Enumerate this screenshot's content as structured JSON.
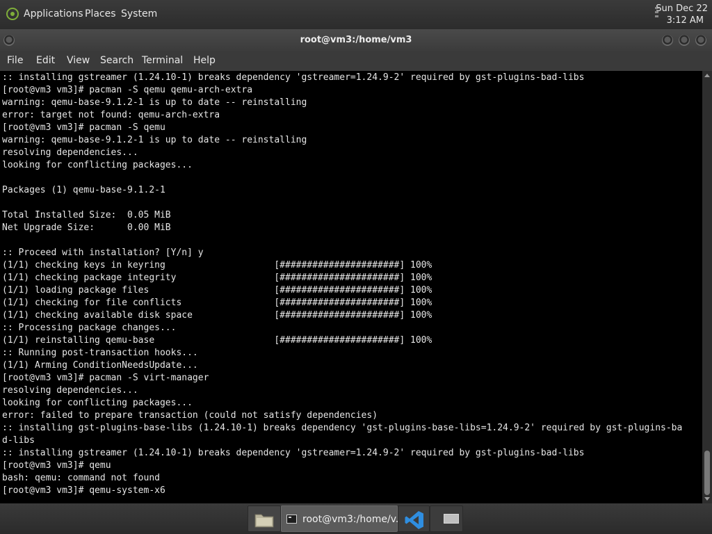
{
  "top_panel": {
    "menus": [
      "Applications",
      "Places",
      "System"
    ],
    "clock_date": "Sun Dec 22",
    "clock_time": "3:12 AM"
  },
  "window": {
    "title": "root@vm3:/home/vm3",
    "menubar": [
      "File",
      "Edit",
      "View",
      "Search",
      "Terminal",
      "Help"
    ]
  },
  "terminal": {
    "lines": [
      ":: installing gstreamer (1.24.10-1) breaks dependency 'gstreamer=1.24.9-2' required by gst-plugins-bad-libs",
      "[root@vm3 vm3]# pacman -S qemu qemu-arch-extra",
      "warning: qemu-base-9.1.2-1 is up to date -- reinstalling",
      "error: target not found: qemu-arch-extra",
      "[root@vm3 vm3]# pacman -S qemu",
      "warning: qemu-base-9.1.2-1 is up to date -- reinstalling",
      "resolving dependencies...",
      "looking for conflicting packages...",
      "",
      "Packages (1) qemu-base-9.1.2-1",
      "",
      "Total Installed Size:  0.05 MiB",
      "Net Upgrade Size:      0.00 MiB",
      "",
      ":: Proceed with installation? [Y/n] y",
      "(1/1) checking keys in keyring                    [######################] 100%",
      "(1/1) checking package integrity                  [######################] 100%",
      "(1/1) loading package files                       [######################] 100%",
      "(1/1) checking for file conflicts                 [######################] 100%",
      "(1/1) checking available disk space               [######################] 100%",
      ":: Processing package changes...",
      "(1/1) reinstalling qemu-base                      [######################] 100%",
      ":: Running post-transaction hooks...",
      "(1/1) Arming ConditionNeedsUpdate...",
      "[root@vm3 vm3]# pacman -S virt-manager",
      "resolving dependencies...",
      "looking for conflicting packages...",
      "error: failed to prepare transaction (could not satisfy dependencies)",
      ":: installing gst-plugins-base-libs (1.24.10-1) breaks dependency 'gst-plugins-base-libs=1.24.9-2' required by gst-plugins-ba",
      "d-libs",
      ":: installing gstreamer (1.24.10-1) breaks dependency 'gstreamer=1.24.9-2' required by gst-plugins-bad-libs",
      "[root@vm3 vm3]# qemu",
      "bash: qemu: command not found",
      "[root@vm3 vm3]# qemu-system-x6"
    ]
  },
  "taskbar": {
    "terminal_task_label": "root@vm3:/home/v...",
    "icons": [
      "file-manager-icon",
      "terminal-icon",
      "vscode-icon",
      "show-desktop-icon"
    ]
  }
}
